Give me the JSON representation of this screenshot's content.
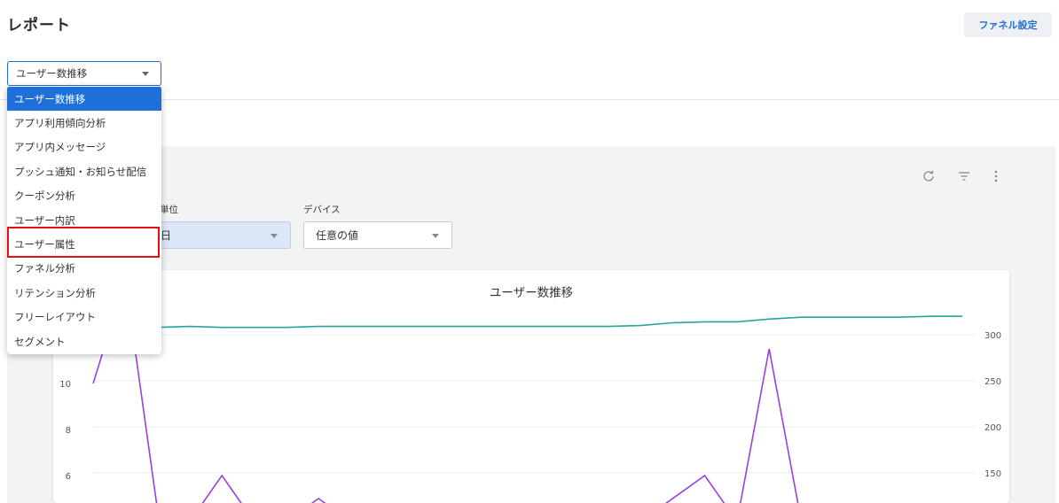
{
  "page": {
    "title": "レポート"
  },
  "header": {
    "funnel_settings_label": "ファネル設定"
  },
  "report_select": {
    "value": "ユーザー数推移",
    "options": [
      "ユーザー数推移",
      "アプリ利用傾向分析",
      "アプリ内メッセージ",
      "プッシュ通知・お知らせ配信",
      "クーポン分析",
      "ユーザー内訳",
      "ユーザー属性",
      "ファネル分析",
      "リテンション分析",
      "フリーレイアウト",
      "セグメント"
    ],
    "highlighted_option": "ユーザー属性"
  },
  "filters": {
    "unit_label_visible": "単位",
    "unit_value_visible": "日",
    "device_label": "デバイス",
    "device_value": "任意の値"
  },
  "toolbar_icons": [
    "refresh-icon",
    "filter-icon",
    "more-vert-icon"
  ],
  "chart_data": {
    "type": "line",
    "title": "ユーザー数推移",
    "left_axis_ticks": [
      "10",
      "8",
      "6"
    ],
    "right_axis_ticks": [
      "300",
      "250",
      "200",
      "150"
    ],
    "series": [
      {
        "color": "#26a69a",
        "axis": "right",
        "values": [
          308,
          308,
          308,
          309,
          308,
          308,
          308,
          309,
          309,
          309,
          309,
          309,
          309,
          309,
          309,
          309,
          309,
          310,
          313,
          314,
          314,
          317,
          319,
          319,
          319,
          319,
          320,
          320
        ]
      },
      {
        "color": "#9b3fe0",
        "axis": "left",
        "values": [
          10,
          14.5,
          4.5,
          4,
          6,
          4,
          4,
          5,
          4,
          4,
          4,
          4,
          4,
          4,
          4,
          4,
          4,
          4,
          5,
          6,
          4,
          11.5,
          4,
          4,
          4,
          4,
          4,
          4
        ]
      }
    ]
  },
  "colors": {
    "accent": "#1f6fd9",
    "highlight": "#e01010"
  }
}
